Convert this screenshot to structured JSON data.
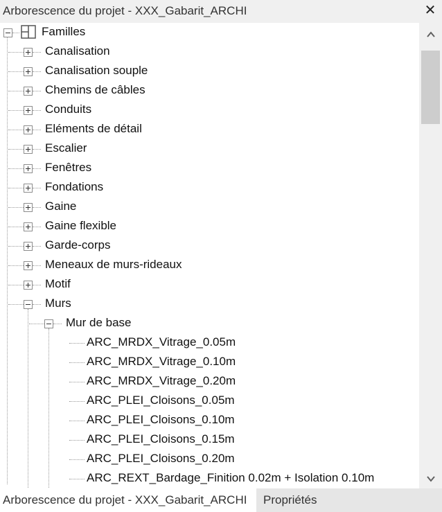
{
  "window": {
    "title": "Arborescence du projet - XXX_Gabarit_ARCHI",
    "close_symbol": "✕"
  },
  "tree": {
    "root": {
      "label": "Familles",
      "icon": "family-icon"
    },
    "categories": [
      {
        "label": "Canalisation",
        "expanded": false
      },
      {
        "label": "Canalisation souple",
        "expanded": false
      },
      {
        "label": "Chemins de câbles",
        "expanded": false
      },
      {
        "label": "Conduits",
        "expanded": false
      },
      {
        "label": "Eléments de détail",
        "expanded": false
      },
      {
        "label": "Escalier",
        "expanded": false
      },
      {
        "label": "Fenêtres",
        "expanded": false
      },
      {
        "label": "Fondations",
        "expanded": false
      },
      {
        "label": "Gaine",
        "expanded": false
      },
      {
        "label": "Gaine flexible",
        "expanded": false
      },
      {
        "label": "Garde-corps",
        "expanded": false
      },
      {
        "label": "Meneaux de murs-rideaux",
        "expanded": false
      },
      {
        "label": "Motif",
        "expanded": false
      },
      {
        "label": "Murs",
        "expanded": true
      }
    ],
    "subfamily": {
      "label": "Mur de base",
      "expanded": true
    },
    "types": [
      "ARC_MRDX_Vitrage_0.05m",
      "ARC_MRDX_Vitrage_0.10m",
      "ARC_MRDX_Vitrage_0.20m",
      "ARC_PLEI_Cloisons_0.05m",
      "ARC_PLEI_Cloisons_0.10m",
      "ARC_PLEI_Cloisons_0.15m",
      "ARC_PLEI_Cloisons_0.20m",
      "ARC_REXT_Bardage_Finition 0.02m + Isolation 0.10m"
    ]
  },
  "scrollbar": {
    "position": 0.0
  },
  "tabs": [
    {
      "label": "Arborescence du projet - XXX_Gabarit_ARCHI",
      "active": true
    },
    {
      "label": "Propriétés",
      "active": false
    }
  ]
}
